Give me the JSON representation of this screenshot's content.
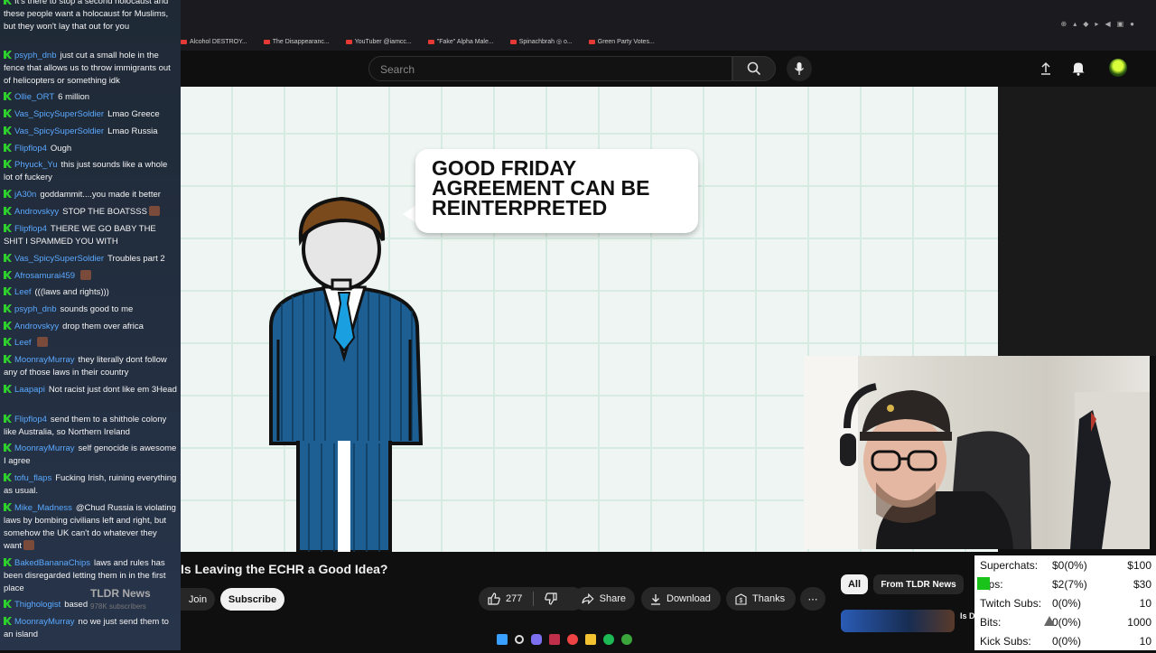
{
  "browser": {
    "bookmarks": [
      "Alcohol DESTROY...",
      "The Disappearanc...",
      "YouTuber @iamcc...",
      "\"Fake\" Alpha Male...",
      "Spinachbrah ◎ o...",
      "Green Party Votes..."
    ]
  },
  "youtube": {
    "search_placeholder": "Search",
    "video_title": "Is Leaving the ECHR a Good Idea?",
    "channel": {
      "name": "TLDR News",
      "subscribers": "978K subscribers"
    },
    "join_label": "Join",
    "subscribe_label": "Subscribe",
    "likes": "277",
    "share_label": "Share",
    "download_label": "Download",
    "thanks_label": "Thanks",
    "chips": {
      "all": "All",
      "from_channel": "From TLDR News"
    },
    "rec_title": "Is D"
  },
  "video": {
    "speech_text": "GOOD FRIDAY AGREEMENT CAN BE REINTERPRETED"
  },
  "stats": [
    {
      "label": "Superchats:",
      "value": "$0(0%)",
      "goal": "$100"
    },
    {
      "label": "Tips:",
      "value": "$2(7%)",
      "goal": "$30"
    },
    {
      "label": "Twitch Subs:",
      "value": "0(0%)",
      "goal": "10"
    },
    {
      "label": "Bits:",
      "value": "0(0%)",
      "goal": "1000"
    },
    {
      "label": "Kick Subs:",
      "value": "0(0%)",
      "goal": "10"
    }
  ],
  "chat": [
    {
      "user": "",
      "text": "It's there to stop a second holocaust and these people want a holocaust for Muslims, but they won't lay that out for you",
      "emote": false
    },
    {
      "user": "psyph_dnb",
      "text": "just cut a small hole in the fence that allows us to throw immigrants out of helicopters or something idk",
      "emote": false
    },
    {
      "user": "Ollie_ORT",
      "text": "6 million",
      "emote": false
    },
    {
      "user": "Vas_SpicySuperSoldier",
      "text": "Lmao Greece",
      "emote": false
    },
    {
      "user": "Vas_SpicySuperSoldier",
      "text": "Lmao Russia",
      "emote": false
    },
    {
      "user": "Flipflop4",
      "text": "Ough",
      "emote": false
    },
    {
      "user": "Phyuck_Yu",
      "text": "this just sounds like a whole lot of fuckery",
      "emote": false
    },
    {
      "user": "jA30n",
      "text": "goddammit....you made it better",
      "emote": false
    },
    {
      "user": "Androvskyy",
      "text": "STOP THE BOATSSS",
      "emote": true
    },
    {
      "user": "Flipflop4",
      "text": "THERE WE GO BABY THE SHIT I SPAMMED YOU WITH",
      "emote": false
    },
    {
      "user": "Vas_SpicySuperSoldier",
      "text": "Troubles part 2",
      "emote": false
    },
    {
      "user": "Afrosamurai459",
      "text": "",
      "emote": true
    },
    {
      "user": "Leef",
      "text": "(((laws and rights)))",
      "emote": false
    },
    {
      "user": "psyph_dnb",
      "text": "sounds good to me",
      "emote": false
    },
    {
      "user": "Androvskyy",
      "text": "drop them over africa",
      "emote": false
    },
    {
      "user": "Leef",
      "text": "",
      "emote": true
    },
    {
      "user": "MoonrayMurray",
      "text": "they literally dont follow any of those laws in their country",
      "emote": false
    },
    {
      "user": "Laapapi",
      "text": "Not racist just dont like em 3Head",
      "emote": false
    },
    {
      "user": "Flipflop4",
      "text": "send them to a shithole colony like Australia, so Northern Ireland",
      "emote": false
    },
    {
      "user": "MoonrayMurray",
      "text": "self genocide is awesome I agree",
      "emote": false
    },
    {
      "user": "tofu_flaps",
      "text": "Fucking Irish, ruining everything as usual.",
      "emote": false
    },
    {
      "user": "Mike_Madness",
      "text": "@Chud Russia is violating laws by bombing civilians left and right, but somehow the UK can't do whatever they want",
      "emote": true
    },
    {
      "user": "BakedBananaChips",
      "text": "laws and rules has been disregarded letting them in in the first place",
      "emote": false
    },
    {
      "user": "Thighologist",
      "text": "based",
      "emote": false
    },
    {
      "user": "MoonrayMurray",
      "text": "no we just send them to an island",
      "emote": false
    }
  ]
}
